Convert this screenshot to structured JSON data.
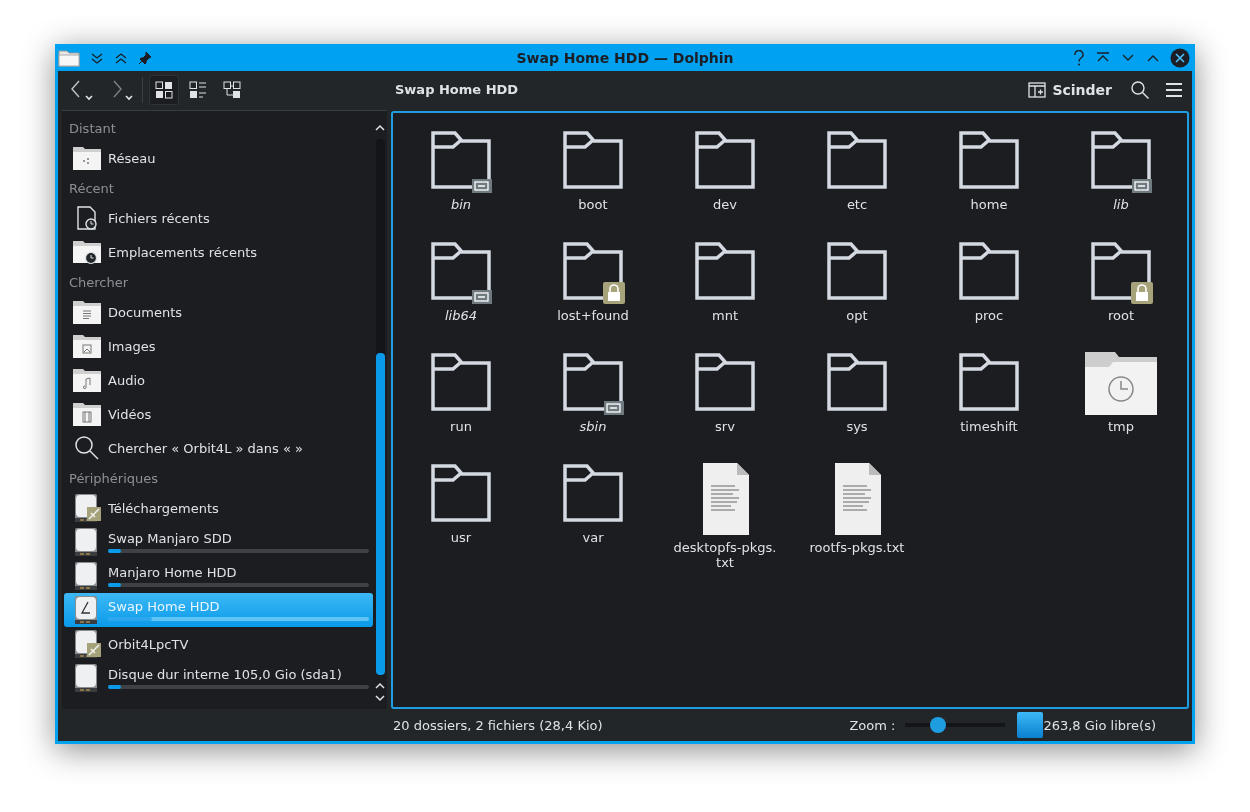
{
  "window": {
    "title": "Swap Home HDD — Dolphin"
  },
  "toolbar": {
    "view_modes": [
      {
        "kind": "icons",
        "selected": true
      },
      {
        "kind": "compact",
        "selected": false
      },
      {
        "kind": "details",
        "selected": false
      }
    ],
    "location": "Swap Home HDD",
    "split_label": "Scinder"
  },
  "sidebar": {
    "sections": [
      {
        "title": "Distant",
        "items": [
          {
            "label": "Réseau",
            "kind": "network",
            "selected": false
          }
        ]
      },
      {
        "title": "Récent",
        "items": [
          {
            "label": "Fichiers récents",
            "kind": "recent-file",
            "selected": false
          },
          {
            "label": "Emplacements récents",
            "kind": "recent-folder",
            "selected": false
          }
        ]
      },
      {
        "title": "Chercher",
        "items": [
          {
            "label": "Documents",
            "kind": "documents",
            "selected": false
          },
          {
            "label": "Images",
            "kind": "images",
            "selected": false
          },
          {
            "label": "Audio",
            "kind": "audio",
            "selected": false
          },
          {
            "label": "Vidéos",
            "kind": "videos",
            "selected": false
          },
          {
            "label": "Chercher « Orbit4L » dans «  »",
            "kind": "search",
            "selected": false
          }
        ]
      },
      {
        "title": "Périphériques",
        "items": [
          {
            "label": "Téléchargements",
            "kind": "remote-drive",
            "selected": false
          },
          {
            "label": "Swap Manjaro SDD",
            "kind": "drive",
            "level": 0.05,
            "selected": false
          },
          {
            "label": "Manjaro Home HDD",
            "kind": "drive",
            "level": 0.05,
            "selected": false
          },
          {
            "label": "Swap Home HDD",
            "kind": "root-drive",
            "level": 0.17,
            "selected": true
          },
          {
            "label": "Orbit4LpcTV",
            "kind": "remote-drive",
            "selected": false
          },
          {
            "label": "Disque dur interne 105,0 Gio (sda1)",
            "kind": "drive",
            "level": 0.05,
            "selected": false
          }
        ]
      }
    ]
  },
  "files": [
    {
      "name": "bin",
      "kind": "symlink-folder"
    },
    {
      "name": "boot",
      "kind": "folder"
    },
    {
      "name": "dev",
      "kind": "folder"
    },
    {
      "name": "etc",
      "kind": "folder"
    },
    {
      "name": "home",
      "kind": "folder"
    },
    {
      "name": "lib",
      "kind": "symlink-folder"
    },
    {
      "name": "lib64",
      "kind": "symlink-folder"
    },
    {
      "name": "lost+found",
      "kind": "locked-folder"
    },
    {
      "name": "mnt",
      "kind": "folder"
    },
    {
      "name": "opt",
      "kind": "folder"
    },
    {
      "name": "proc",
      "kind": "folder"
    },
    {
      "name": "root",
      "kind": "locked-folder"
    },
    {
      "name": "run",
      "kind": "folder"
    },
    {
      "name": "sbin",
      "kind": "symlink-folder"
    },
    {
      "name": "srv",
      "kind": "folder"
    },
    {
      "name": "sys",
      "kind": "folder"
    },
    {
      "name": "timeshift",
      "kind": "folder"
    },
    {
      "name": "tmp",
      "kind": "temp-folder"
    },
    {
      "name": "usr",
      "kind": "folder"
    },
    {
      "name": "var",
      "kind": "folder"
    },
    {
      "name": "desktopfs-pkgs.\ntxt",
      "kind": "text"
    },
    {
      "name": "rootfs-pkgs.txt",
      "kind": "text"
    }
  ],
  "status_bar": {
    "summary": "20 dossiers, 2 fichiers (28,4 Kio)",
    "zoom": {
      "label": "Zoom :",
      "level": 0.33
    },
    "free_space": "263,8 Gio libre(s)"
  }
}
